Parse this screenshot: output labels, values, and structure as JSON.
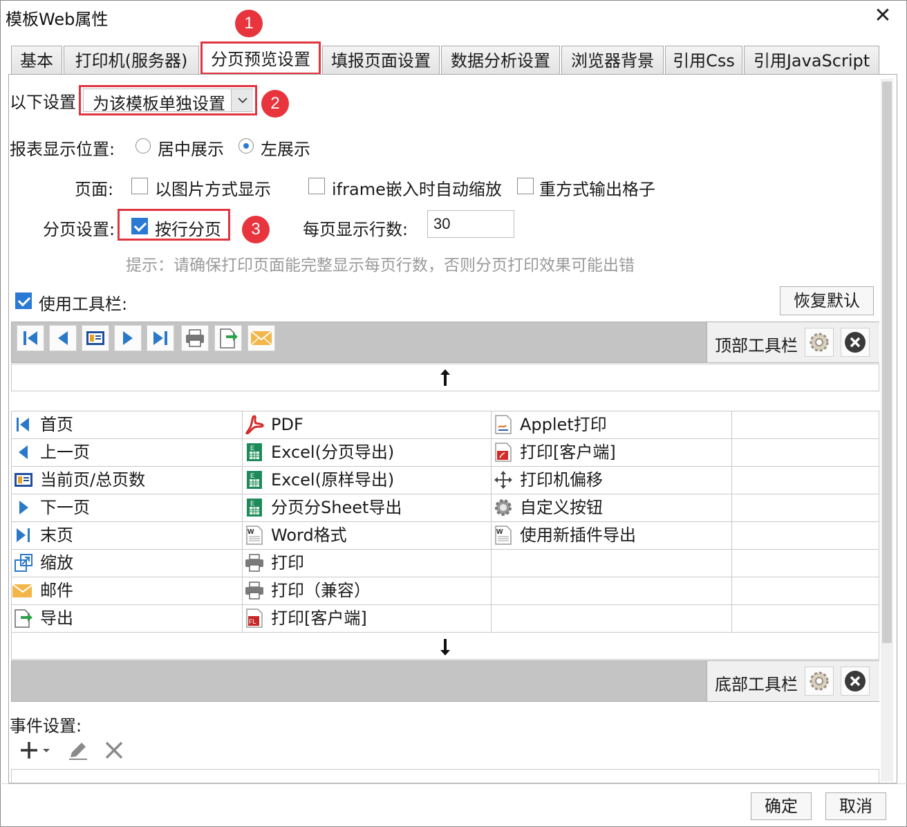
{
  "window": {
    "title": "模板Web属性"
  },
  "tabs": [
    {
      "label": "基本"
    },
    {
      "label": "打印机(服务器)"
    },
    {
      "label": "分页预览设置"
    },
    {
      "label": "填报页面设置"
    },
    {
      "label": "数据分析设置"
    },
    {
      "label": "浏览器背景"
    },
    {
      "label": "引用Css"
    },
    {
      "label": "引用JavaScript"
    }
  ],
  "badges": [
    "1",
    "2",
    "3"
  ],
  "settings": {
    "scope_label": "以下设置",
    "scope_value": "为该模板单独设置",
    "position_label": "报表显示位置:",
    "position_options": [
      "居中展示",
      "左展示"
    ],
    "position_selected": "左展示",
    "page_label": "页面:",
    "page_options": [
      "以图片方式显示",
      "iframe嵌入时自动缩放",
      "重方式输出格子"
    ],
    "paging_label": "分页设置:",
    "paging_checkbox": "按行分页",
    "paging_checked": true,
    "rows_label": "每页显示行数:",
    "rows_value": "30",
    "hint": "提示：请确保打印页面能完整显示每页行数，否则分页打印效果可能出错"
  },
  "toolbar": {
    "use_label": "使用工具栏:",
    "use_checked": true,
    "restore_label": "恢复默认",
    "top_label": "顶部工具栏",
    "bottom_label": "底部工具栏",
    "top_buttons": [
      "first-page-icon",
      "prev-page-icon",
      "page-count-icon",
      "next-page-icon",
      "last-page-icon",
      "print-icon",
      "export-icon",
      "email-icon"
    ]
  },
  "items": {
    "col1": [
      {
        "label": "首页",
        "icon": "first-page-icon"
      },
      {
        "label": "上一页",
        "icon": "prev-page-icon"
      },
      {
        "label": "当前页/总页数",
        "icon": "page-count-icon"
      },
      {
        "label": "下一页",
        "icon": "next-page-icon"
      },
      {
        "label": "末页",
        "icon": "last-page-icon"
      },
      {
        "label": "缩放",
        "icon": "zoom-icon"
      },
      {
        "label": "邮件",
        "icon": "email-icon"
      },
      {
        "label": "导出",
        "icon": "export-icon"
      }
    ],
    "col2": [
      {
        "label": "PDF",
        "icon": "pdf-icon"
      },
      {
        "label": "Excel(分页导出)",
        "icon": "excel-icon"
      },
      {
        "label": "Excel(原样导出)",
        "icon": "excel-icon"
      },
      {
        "label": "分页分Sheet导出",
        "icon": "excel-icon"
      },
      {
        "label": "Word格式",
        "icon": "word-icon"
      },
      {
        "label": "打印",
        "icon": "print-icon"
      },
      {
        "label": "打印（兼容）",
        "icon": "print-icon"
      },
      {
        "label": "打印[客户端]",
        "icon": "flash-print-icon"
      }
    ],
    "col3": [
      {
        "label": "Applet打印",
        "icon": "applet-print-icon"
      },
      {
        "label": "打印[客户端]",
        "icon": "pdf-print-icon"
      },
      {
        "label": "打印机偏移",
        "icon": "move-icon"
      },
      {
        "label": "自定义按钮",
        "icon": "gear-icon"
      },
      {
        "label": "使用新插件导出",
        "icon": "word-icon"
      }
    ]
  },
  "events": {
    "label": "事件设置:"
  },
  "footer": {
    "ok": "确定",
    "cancel": "取消"
  },
  "colors": {
    "highlight": "#e0353f",
    "accent": "#2a7ad5",
    "badge": "#e8343d"
  }
}
